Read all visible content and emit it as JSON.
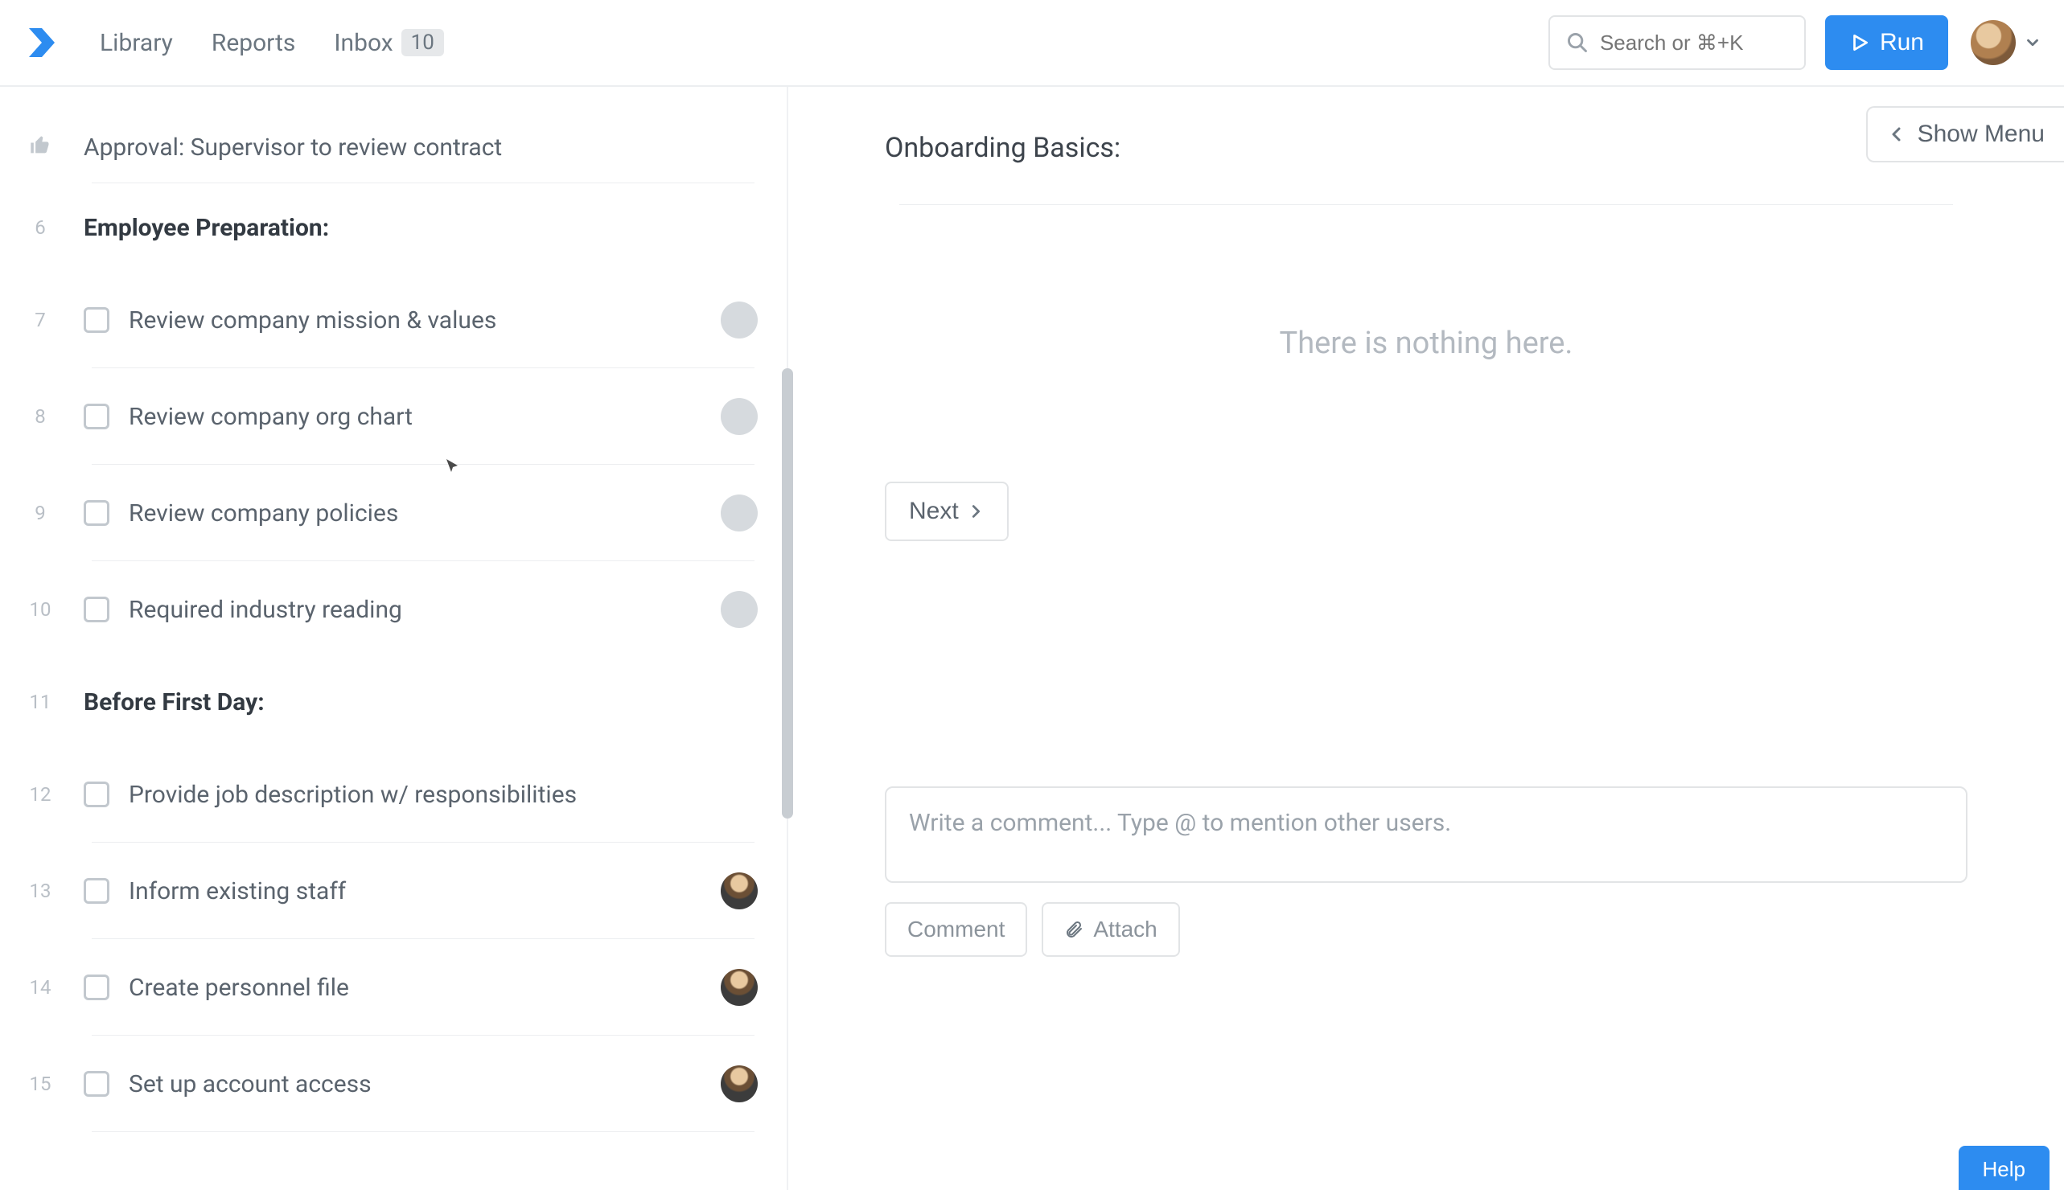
{
  "header": {
    "nav": {
      "library": "Library",
      "reports": "Reports",
      "inbox": "Inbox",
      "inbox_count": "10"
    },
    "search_placeholder": "Search or ⌘+K",
    "run_label": "Run",
    "show_menu": "Show Menu"
  },
  "left": {
    "approval": {
      "num": "",
      "label": "Approval: Supervisor to review contract"
    },
    "section1": {
      "num": "6",
      "title": "Employee Preparation:"
    },
    "items1": [
      {
        "num": "7",
        "label": "Review company mission & values",
        "avatar": "blank"
      },
      {
        "num": "8",
        "label": "Review company org chart",
        "avatar": "blank"
      },
      {
        "num": "9",
        "label": "Review company policies",
        "avatar": "blank"
      },
      {
        "num": "10",
        "label": "Required industry reading",
        "avatar": "blank"
      }
    ],
    "section2": {
      "num": "11",
      "title": "Before First Day:"
    },
    "items2": [
      {
        "num": "12",
        "label": "Provide job description w/ responsibilities",
        "avatar": ""
      },
      {
        "num": "13",
        "label": "Inform existing staff",
        "avatar": "person"
      },
      {
        "num": "14",
        "label": "Create personnel file",
        "avatar": "person"
      },
      {
        "num": "15",
        "label": "Set up account access",
        "avatar": "person"
      }
    ]
  },
  "right": {
    "title": "Onboarding Basics:",
    "empty": "There is nothing here.",
    "next": "Next",
    "comment_placeholder": "Write a comment... Type @ to mention other users.",
    "comment_btn": "Comment",
    "attach_btn": "Attach",
    "help": "Help"
  }
}
